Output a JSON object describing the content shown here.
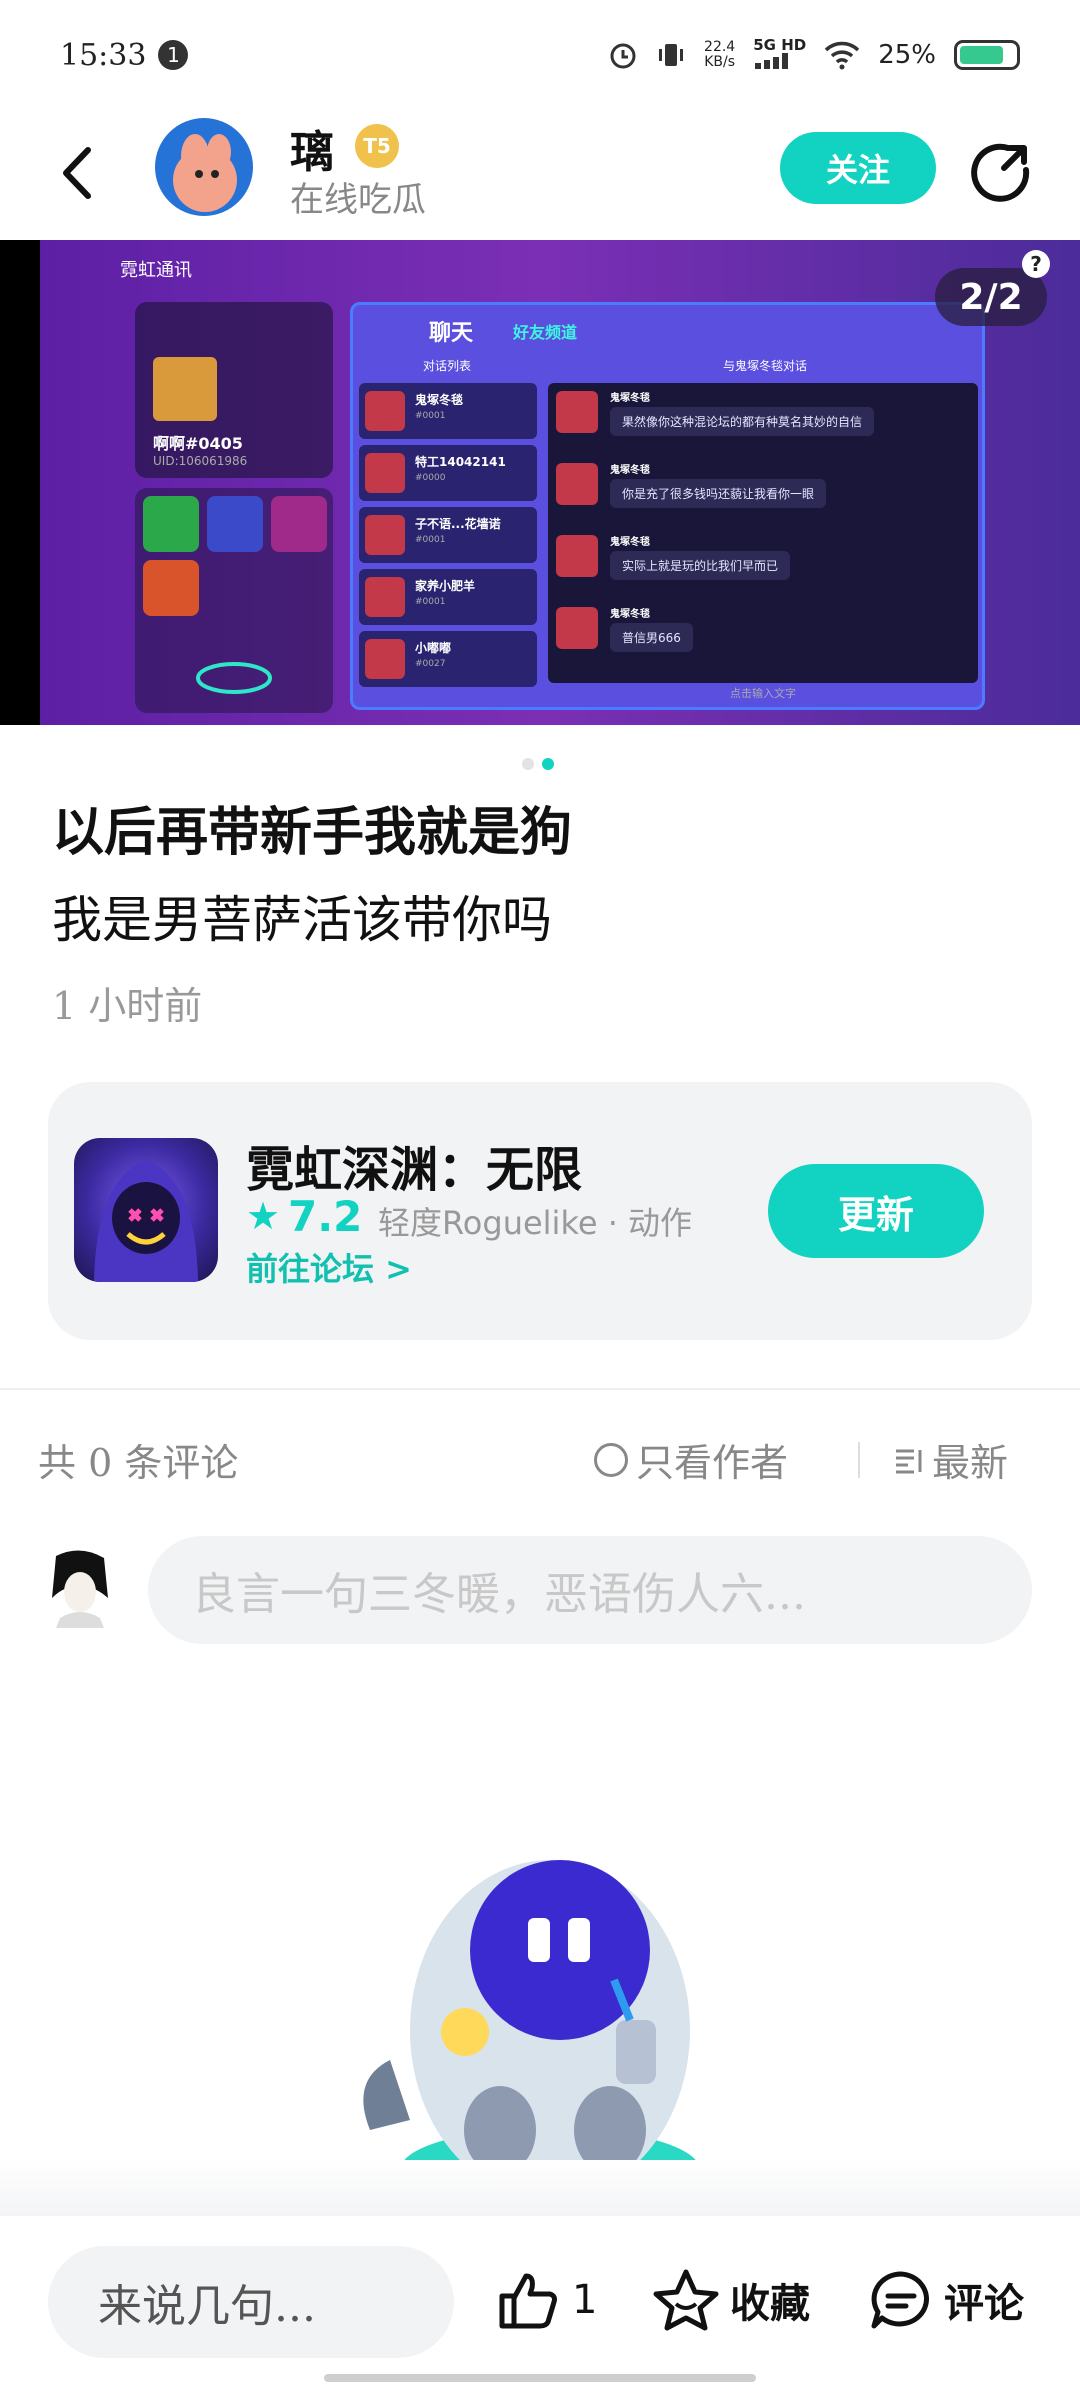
{
  "status_bar": {
    "time": "15:33",
    "notification_count": "1",
    "net_speed": "22.4",
    "net_speed_unit": "KB/s",
    "network": "5G HD",
    "battery": "25%",
    "battery_level": 0.25
  },
  "header": {
    "username": "璃",
    "level": "5",
    "subtitle": "在线吃瓜",
    "follow_label": "关注"
  },
  "banner": {
    "counter": "2/2",
    "help": "?",
    "app_title": "霓虹通讯",
    "profile_name": "啊啊#0405",
    "profile_uid": "UID:106061986",
    "chat_title": "聊天",
    "chat_tab": "好友频道",
    "list_label": "对话列表",
    "conv_label": "与鬼塚冬毯对话",
    "list_items": [
      {
        "name": "鬼塚冬毯",
        "sub": "#0001"
      },
      {
        "name": "特工14042141",
        "sub": "#0000"
      },
      {
        "name": "子不语...花墙诺",
        "sub": "#0001"
      },
      {
        "name": "家养小肥羊",
        "sub": "#0001"
      },
      {
        "name": "小嘟嘟",
        "sub": "#0027"
      }
    ],
    "messages": [
      {
        "name": "鬼塚冬毯",
        "text": "果然像你这种混论坛的都有种莫名其妙的自信"
      },
      {
        "name": "鬼塚冬毯",
        "text": "你是充了很多钱吗还藐让我看你一眼"
      },
      {
        "name": "鬼塚冬毯",
        "text": "实际上就是玩的比我们早而已"
      },
      {
        "name": "鬼塚冬毯",
        "text": "普信男666"
      }
    ],
    "input_placeholder": "点击输入文字"
  },
  "post": {
    "title": "以后再带新手我就是狗",
    "body": "我是男菩萨活该带你吗",
    "time": "1 小时前"
  },
  "game": {
    "name": "霓虹深渊：无限",
    "rating": "7.2",
    "tags": "轻度Roguelike · 动作",
    "forum_link": "前往论坛 >",
    "update_label": "更新"
  },
  "comments": {
    "count_label": "共 0 条评论",
    "author_only": "只看作者",
    "sort": "最新",
    "input_placeholder": "良言一句三冬暖，恶语伤人六..."
  },
  "bottom_bar": {
    "say_placeholder": "来说几句...",
    "like_count": "1",
    "favorite_label": "收藏",
    "comment_label": "评论"
  },
  "colors": {
    "accent": "#12d3c1",
    "banner_purple": "#6a2ab0"
  }
}
